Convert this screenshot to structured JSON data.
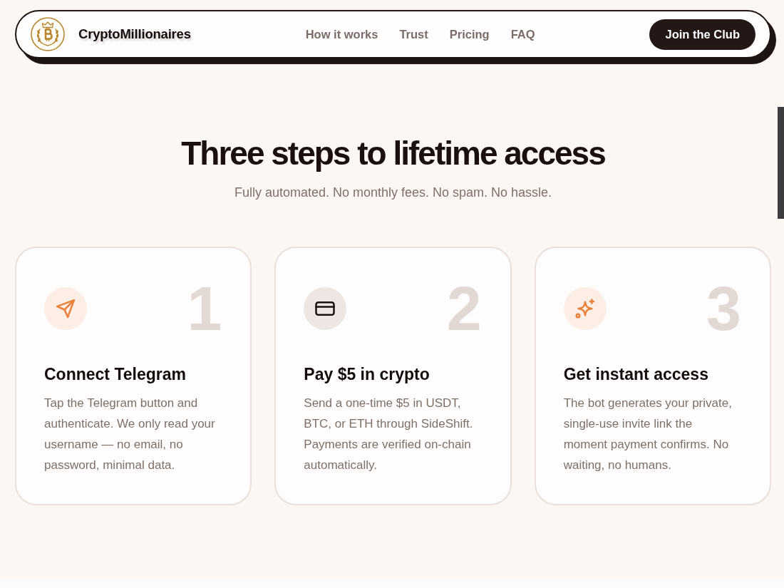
{
  "nav": {
    "brand": "CryptoMillionaires",
    "links": [
      "How it works",
      "Trust",
      "Pricing",
      "FAQ"
    ],
    "cta": "Join the Club"
  },
  "steps_section": {
    "title": "Three steps to lifetime access",
    "subtitle": "Fully automated. No monthly fees. No spam. No hassle.",
    "steps": [
      {
        "number": "1",
        "title": "Connect Telegram",
        "description": "Tap the Telegram button and authenticate. We only read your username — no email, no password, minimal data.",
        "color": "#e8803a"
      },
      {
        "number": "2",
        "title": "Pay $5 in crypto",
        "description": "Send a one-time $5 in USDT, BTC, or ETH through SideShift. Payments are verified on-chain automatically.",
        "color": "#1a1210"
      },
      {
        "number": "3",
        "title": "Get instant access",
        "description": "The bot generates your private, single-use invite link the moment payment confirms. No waiting, no humans.",
        "color": "#e8803a"
      }
    ]
  }
}
